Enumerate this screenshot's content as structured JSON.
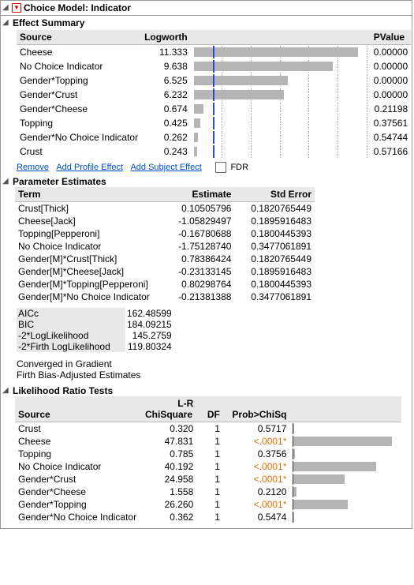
{
  "main": {
    "title": "Choice Model: Indicator"
  },
  "effect_summary": {
    "title": "Effect Summary",
    "headers": {
      "source": "Source",
      "logworth": "Logworth",
      "pvalue": "PValue"
    },
    "rows": [
      {
        "source": "Cheese",
        "logworth": "11.333",
        "pvalue": "0.00000"
      },
      {
        "source": "No Choice Indicator",
        "logworth": "9.638",
        "pvalue": "0.00000"
      },
      {
        "source": "Gender*Topping",
        "logworth": "6.525",
        "pvalue": "0.00000"
      },
      {
        "source": "Gender*Crust",
        "logworth": "6.232",
        "pvalue": "0.00000"
      },
      {
        "source": "Gender*Cheese",
        "logworth": "0.674",
        "pvalue": "0.21198"
      },
      {
        "source": "Topping",
        "logworth": "0.425",
        "pvalue": "0.37561"
      },
      {
        "source": "Gender*No Choice Indicator",
        "logworth": "0.262",
        "pvalue": "0.54744"
      },
      {
        "source": "Crust",
        "logworth": "0.243",
        "pvalue": "0.57166"
      }
    ],
    "links": {
      "remove": "Remove",
      "add_profile": "Add Profile Effect",
      "add_subject": "Add Subject Effect",
      "fdr": "FDR"
    },
    "ref_line_value": 1.3,
    "axis_max": 12
  },
  "parameter_estimates": {
    "title": "Parameter Estimates",
    "headers": {
      "term": "Term",
      "estimate": "Estimate",
      "stderr": "Std Error"
    },
    "rows": [
      {
        "term": "Crust[Thick]",
        "estimate": "0.10505796",
        "stderr": "0.1820765449"
      },
      {
        "term": "Cheese[Jack]",
        "estimate": "-1.05829497",
        "stderr": "0.1895916483"
      },
      {
        "term": "Topping[Pepperoni]",
        "estimate": "-0.16780688",
        "stderr": "0.1800445393"
      },
      {
        "term": "No Choice Indicator",
        "estimate": "-1.75128740",
        "stderr": "0.3477061891"
      },
      {
        "term": "Gender[M]*Crust[Thick]",
        "estimate": "0.78386424",
        "stderr": "0.1820765449"
      },
      {
        "term": "Gender[M]*Cheese[Jack]",
        "estimate": "-0.23133145",
        "stderr": "0.1895916483"
      },
      {
        "term": "Gender[M]*Topping[Pepperoni]",
        "estimate": "0.80298764",
        "stderr": "0.1800445393"
      },
      {
        "term": "Gender[M]*No Choice Indicator",
        "estimate": "-0.21381388",
        "stderr": "0.3477061891"
      }
    ],
    "stats": [
      {
        "label": "AICc",
        "value": "162.48599"
      },
      {
        "label": "BIC",
        "value": "184.09215"
      },
      {
        "label": "-2*LogLikelihood",
        "value": "145.2759"
      },
      {
        "label": "-2*Firth LogLikelihood",
        "value": "119.80324"
      }
    ],
    "notes": [
      "Converged in Gradient",
      "Firth Bias-Adjusted Estimates"
    ]
  },
  "lr_tests": {
    "title": "Likelihood Ratio Tests",
    "headers": {
      "source": "Source",
      "chisq_top": "L-R",
      "chisq_bot": "ChiSquare",
      "df": "DF",
      "prob": "Prob>ChiSq"
    },
    "rows": [
      {
        "source": "Crust",
        "chisq": "0.320",
        "df": "1",
        "prob": "0.5717",
        "sig": false
      },
      {
        "source": "Cheese",
        "chisq": "47.831",
        "df": "1",
        "prob": "<.0001*",
        "sig": true
      },
      {
        "source": "Topping",
        "chisq": "0.785",
        "df": "1",
        "prob": "0.3756",
        "sig": false
      },
      {
        "source": "No Choice Indicator",
        "chisq": "40.192",
        "df": "1",
        "prob": "<.0001*",
        "sig": true
      },
      {
        "source": "Gender*Crust",
        "chisq": "24.958",
        "df": "1",
        "prob": "<.0001*",
        "sig": true
      },
      {
        "source": "Gender*Cheese",
        "chisq": "1.558",
        "df": "1",
        "prob": "0.2120",
        "sig": false
      },
      {
        "source": "Gender*Topping",
        "chisq": "26.260",
        "df": "1",
        "prob": "<.0001*",
        "sig": true
      },
      {
        "source": "Gender*No Choice Indicator",
        "chisq": "0.362",
        "df": "1",
        "prob": "0.5474",
        "sig": false
      }
    ],
    "bar_max": 50
  },
  "chart_data": [
    {
      "type": "bar",
      "title": "Effect Summary Logworth",
      "categories": [
        "Cheese",
        "No Choice Indicator",
        "Gender*Topping",
        "Gender*Crust",
        "Gender*Cheese",
        "Topping",
        "Gender*No Choice Indicator",
        "Crust"
      ],
      "values": [
        11.333,
        9.638,
        6.525,
        6.232,
        0.674,
        0.425,
        0.262,
        0.243
      ],
      "xlim": [
        0,
        12
      ],
      "reference_line": 1.3,
      "ylabel": "",
      "xlabel": "Logworth"
    },
    {
      "type": "bar",
      "title": "Likelihood Ratio ChiSquare",
      "categories": [
        "Crust",
        "Cheese",
        "Topping",
        "No Choice Indicator",
        "Gender*Crust",
        "Gender*Cheese",
        "Gender*Topping",
        "Gender*No Choice Indicator"
      ],
      "values": [
        0.32,
        47.831,
        0.785,
        40.192,
        24.958,
        1.558,
        26.26,
        0.362
      ],
      "xlim": [
        0,
        50
      ],
      "ylabel": "",
      "xlabel": "L-R ChiSquare"
    }
  ]
}
